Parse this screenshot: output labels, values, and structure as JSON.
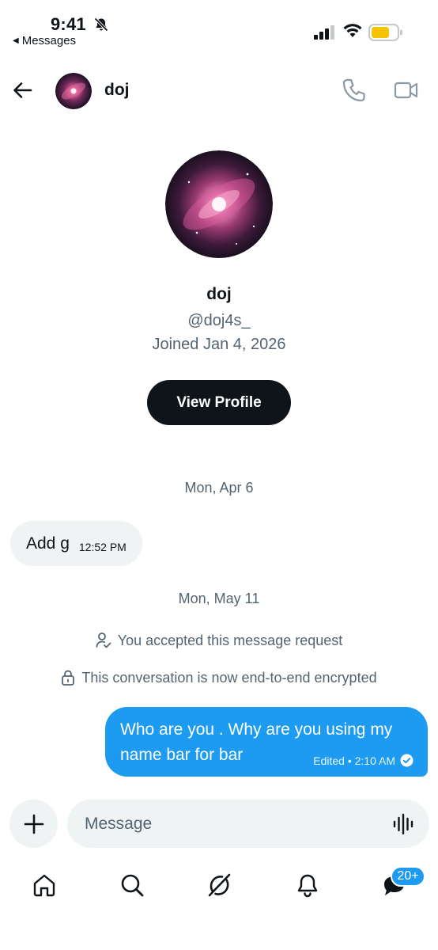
{
  "status_bar": {
    "time": "9:41",
    "back_app": "Messages"
  },
  "header": {
    "name": "doj"
  },
  "profile": {
    "name": "doj",
    "handle": "@doj4s_",
    "joined": "Joined Jan 4, 2026",
    "view_profile_label": "View Profile"
  },
  "conversation": {
    "date_1": "Mon, Apr 6",
    "incoming": {
      "text": "Add g",
      "time": "12:52 PM"
    },
    "date_2": "Mon, May 11",
    "system_1": "You accepted this message request",
    "system_2": "This conversation is now end-to-end encrypted",
    "outgoing": {
      "line_1": "Who are you .  Why are you using my",
      "line_2": "name bar for bar",
      "meta": "Edited • 2:10 AM"
    }
  },
  "compose": {
    "placeholder": "Message"
  },
  "tabs": {
    "messages_badge": "20+"
  },
  "colors": {
    "accent": "#1d9bf0",
    "text": "#0f1419",
    "secondary": "#536471",
    "bubble_in": "#eff3f4",
    "battery": "#f5c400"
  },
  "icons": [
    "bell-off-icon",
    "back-arrow-icon",
    "phone-icon",
    "video-icon",
    "plus-icon",
    "voice-wave-icon",
    "home-icon",
    "search-icon",
    "grok-icon",
    "bell-icon",
    "messages-icon",
    "person-check-icon",
    "lock-icon",
    "check-circle-icon"
  ]
}
